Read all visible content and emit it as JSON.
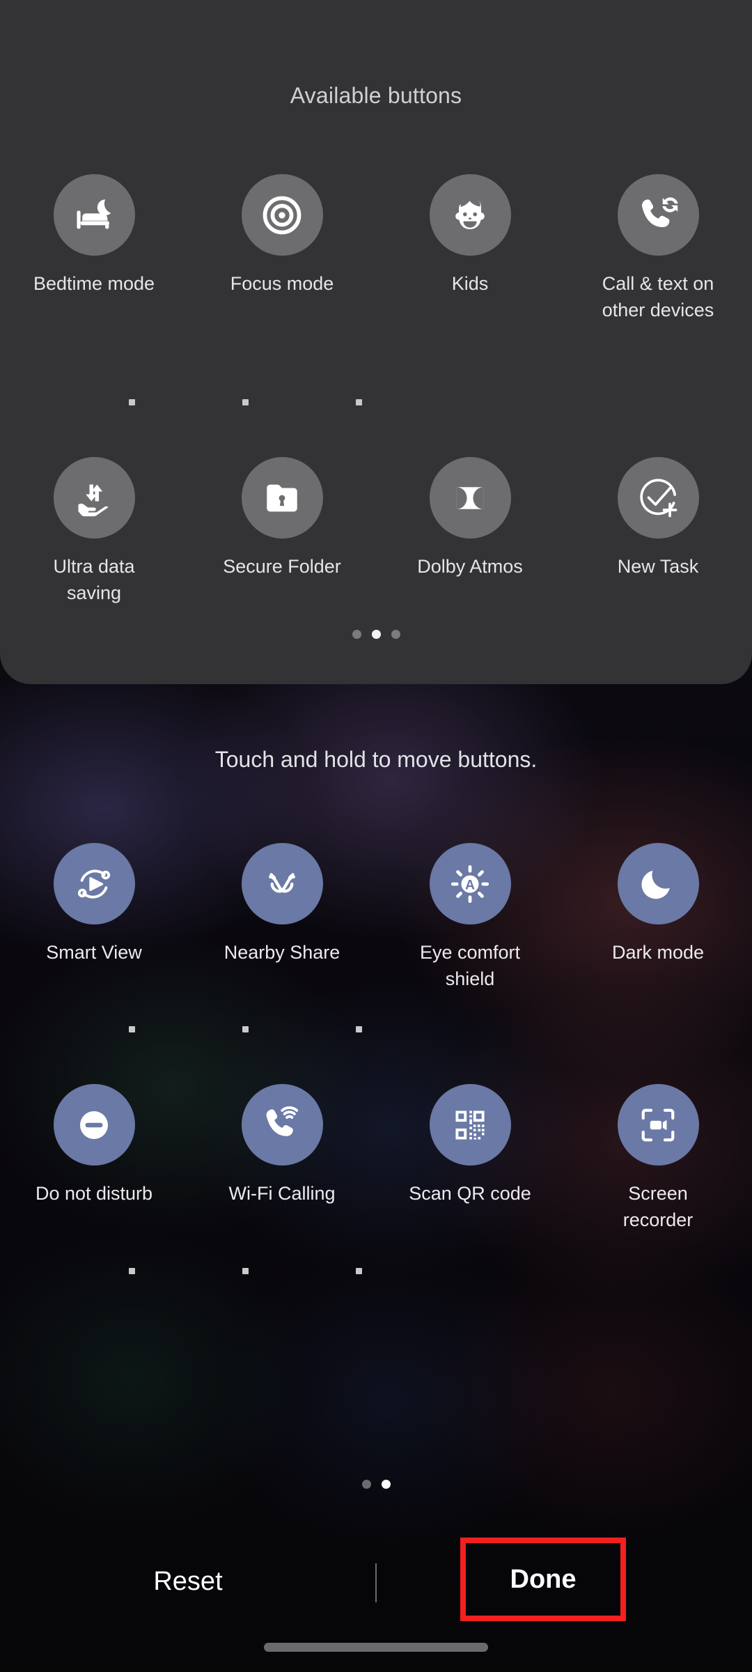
{
  "panel": {
    "title": "Available buttons",
    "page_dots": {
      "count": 3,
      "active_index": 1
    },
    "rows": [
      {
        "buttons": [
          {
            "label": "Bedtime mode",
            "icon": "bedtime-mode-icon"
          },
          {
            "label": "Focus mode",
            "icon": "focus-mode-icon"
          },
          {
            "label": "Kids",
            "icon": "kids-icon"
          },
          {
            "label": "Call & text on other devices",
            "icon": "call-text-other-devices-icon"
          }
        ]
      },
      {
        "buttons": [
          {
            "label": "Ultra data saving",
            "icon": "ultra-data-saving-icon"
          },
          {
            "label": "Secure Folder",
            "icon": "secure-folder-icon"
          },
          {
            "label": "Dolby Atmos",
            "icon": "dolby-atmos-icon"
          },
          {
            "label": "New Task",
            "icon": "new-task-icon"
          }
        ]
      }
    ]
  },
  "hint": "Touch and hold to move buttons.",
  "quick_panel": {
    "page_dots": {
      "count": 2,
      "active_index": 1
    },
    "rows": [
      {
        "buttons": [
          {
            "label": "Smart View",
            "icon": "smart-view-icon"
          },
          {
            "label": "Nearby Share",
            "icon": "nearby-share-icon"
          },
          {
            "label": "Eye comfort shield",
            "icon": "eye-comfort-shield-icon"
          },
          {
            "label": "Dark mode",
            "icon": "dark-mode-icon"
          }
        ]
      },
      {
        "buttons": [
          {
            "label": "Do not disturb",
            "icon": "do-not-disturb-icon"
          },
          {
            "label": "Wi-Fi Calling",
            "icon": "wifi-calling-icon"
          },
          {
            "label": "Scan QR code",
            "icon": "scan-qr-code-icon"
          },
          {
            "label": "Screen recorder",
            "icon": "screen-recorder-icon"
          }
        ]
      }
    ]
  },
  "bottom_bar": {
    "reset_label": "Reset",
    "done_label": "Done"
  },
  "colors": {
    "panel_background": "#333336",
    "available_tile": "#6d6d70",
    "active_tile": "#6a79a5",
    "highlight_outline": "#f41f1f",
    "label_text": "#eceaee"
  }
}
